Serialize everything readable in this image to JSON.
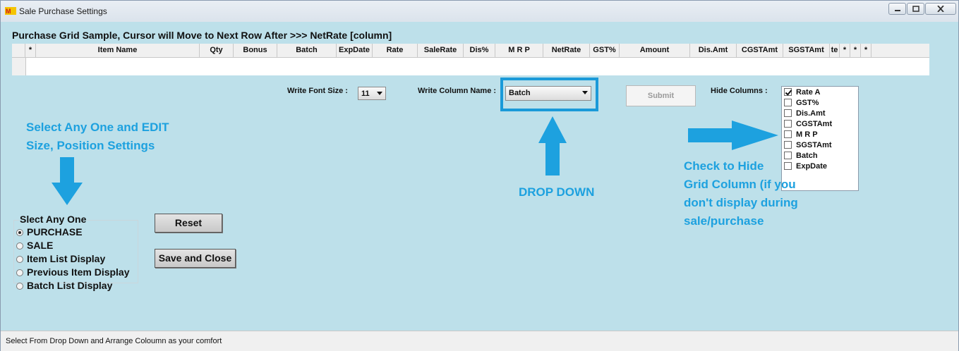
{
  "window": {
    "title": "Sale Purchase Settings",
    "accent": "#1da1df",
    "background": "#bde0ea"
  },
  "heading": "Purchase Grid Sample, Cursor will Move to Next Row After >>> NetRate [column]",
  "grid": {
    "columns": [
      "*",
      "Item Name",
      "Qty",
      "Bonus",
      "Batch",
      "ExpDate",
      "Rate",
      "SaleRate",
      "Dis%",
      "M R P",
      "NetRate",
      "GST%",
      "Amount",
      "Dis.Amt",
      "CGSTAmt",
      "SGSTAmt",
      "te",
      "*",
      "*",
      "*"
    ]
  },
  "controls": {
    "font_size_label": "Write Font Size :",
    "font_size_value": "11",
    "column_name_label": "Write Column Name :",
    "column_name_value": "Batch",
    "submit_label": "Submit",
    "hide_columns_label": "Hide Columns :"
  },
  "hide_columns": [
    {
      "label": "Rate A",
      "checked": true
    },
    {
      "label": "GST%",
      "checked": false
    },
    {
      "label": "Dis.Amt",
      "checked": false
    },
    {
      "label": "CGSTAmt",
      "checked": false
    },
    {
      "label": "M R P",
      "checked": false
    },
    {
      "label": "SGSTAmt",
      "checked": false
    },
    {
      "label": "Batch",
      "checked": false
    },
    {
      "label": "ExpDate",
      "checked": false
    }
  ],
  "notes": {
    "select_edit_1": "Select Any One and EDIT",
    "select_edit_2": "Size, Position Settings",
    "drop_down": "DROP DOWN",
    "hide_1": "Check to Hide",
    "hide_2": "Grid Column (if you",
    "hide_3": "don't display during",
    "hide_4": "sale/purchase"
  },
  "select_group": {
    "title": "Slect Any One",
    "options": [
      {
        "label": "PURCHASE",
        "selected": true
      },
      {
        "label": "SALE",
        "selected": false
      },
      {
        "label": "Item List Display",
        "selected": false
      },
      {
        "label": "Previous Item Display",
        "selected": false
      },
      {
        "label": "Batch List Display",
        "selected": false
      }
    ]
  },
  "buttons": {
    "reset": "Reset",
    "save_close": "Save and Close"
  },
  "status": "Select From Drop Down and Arrange Coloumn as your comfort"
}
